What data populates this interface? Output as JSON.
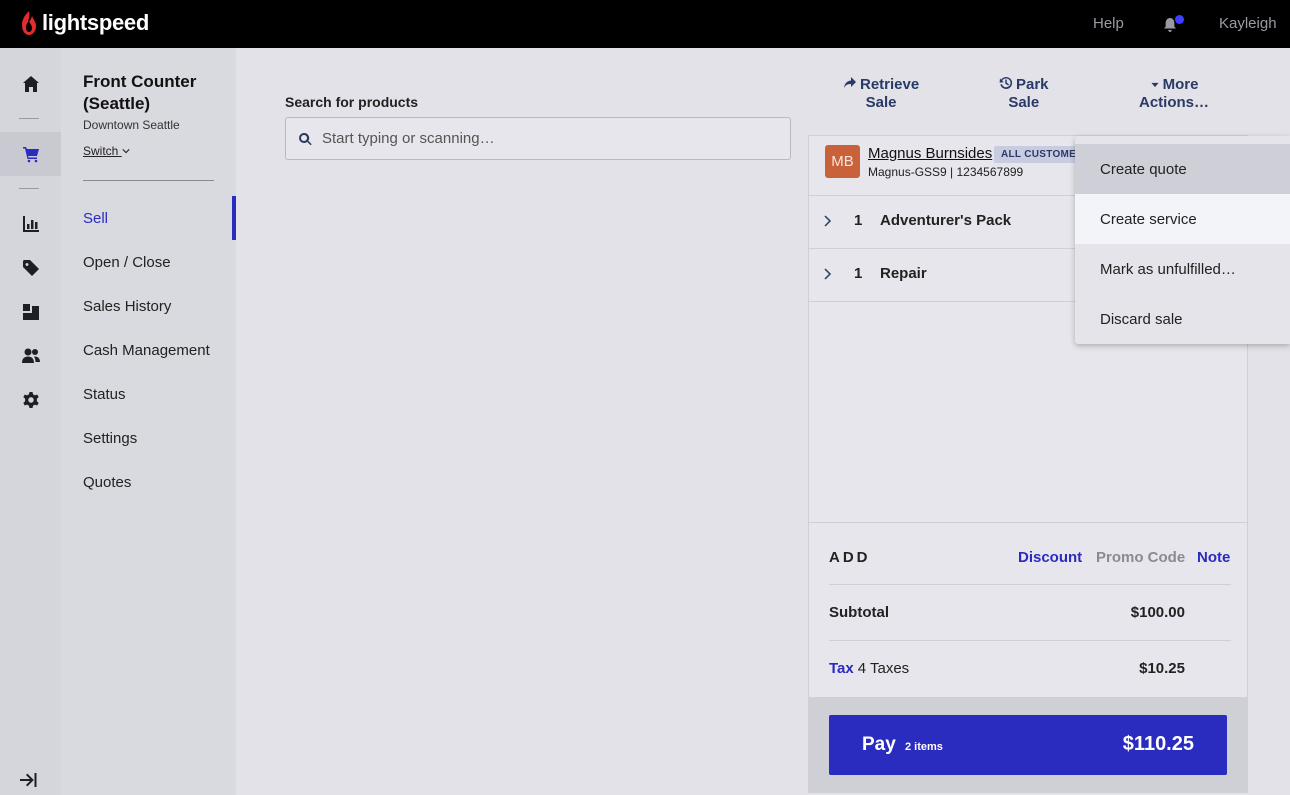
{
  "topbar": {
    "brand": "lightspeed",
    "help": "Help",
    "user": "Kayleigh"
  },
  "rail": {
    "items": [
      "home-icon",
      "cart-icon",
      "reports-icon",
      "tag-icon",
      "inventory-icon",
      "customers-icon",
      "settings-icon"
    ],
    "active": "cart-icon"
  },
  "subnav": {
    "store_title": "Front Counter (Seattle)",
    "store_location": "Downtown Seattle",
    "switch_label": "Switch",
    "items": [
      {
        "label": "Sell",
        "active": true
      },
      {
        "label": "Open / Close"
      },
      {
        "label": "Sales History"
      },
      {
        "label": "Cash Management"
      },
      {
        "label": "Status"
      },
      {
        "label": "Settings"
      },
      {
        "label": "Quotes"
      }
    ]
  },
  "search": {
    "label": "Search for products",
    "placeholder": "Start typing or scanning…"
  },
  "actions": {
    "retrieve_line1": "Retrieve",
    "retrieve_line2": "Sale",
    "park_line1": "Park",
    "park_line2": "Sale",
    "more_line1": "More",
    "more_line2": "Actions…"
  },
  "customer": {
    "initials": "MB",
    "name": "Magnus Burnsides",
    "badge": "ALL CUSTOMERS",
    "meta": "Magnus-GSS9 | 1234567899"
  },
  "line_items": [
    {
      "qty": "1",
      "name": "Adventurer's Pack"
    },
    {
      "qty": "1",
      "name": "Repair"
    }
  ],
  "totals": {
    "add_label": "ADD",
    "discount": "Discount",
    "promo_code": "Promo Code",
    "note": "Note",
    "subtotal_label": "Subtotal",
    "subtotal_value": "$100.00",
    "tax_label": "Tax",
    "tax_desc": "4 Taxes",
    "tax_value": "$10.25"
  },
  "pay": {
    "label": "Pay",
    "items": "2 items",
    "amount": "$110.25"
  },
  "menu": {
    "items": [
      "Create quote",
      "Create service",
      "Mark as unfulfilled…",
      "Discard sale"
    ]
  },
  "colors": {
    "accent": "#2a2bbf",
    "avatar": "#c9623a",
    "brand_red": "#e32d2d"
  }
}
